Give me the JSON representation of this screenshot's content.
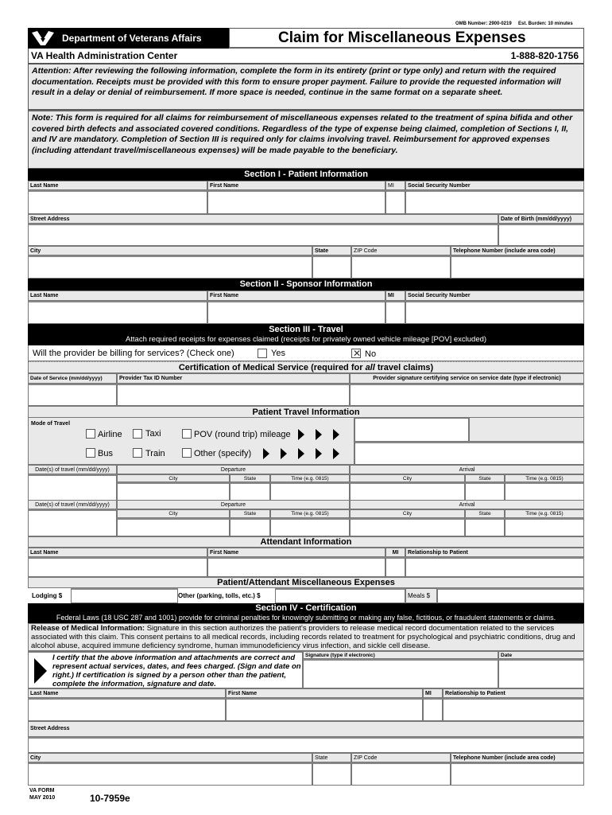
{
  "header": {
    "omb_number": "OMB Number: 2900-0219",
    "est_burden": "Est. Burden: 10 minutes",
    "agency": "Department of Veterans Affairs",
    "form_title": "Claim for Miscellaneous Expenses",
    "center": "VA Health Administration Center",
    "phone": "1-888-820-1756"
  },
  "notices": {
    "attention": "Attention: After reviewing the following information, complete the form in its entirety (print or type only) and return with the required documentation. Receipts must be provided with this form to ensure proper payment.  Failure to provide the requested information will result in a delay or denial of reimbursement. If more space is needed, continue in the same format on a separate sheet.",
    "note": "Note: This form is required for all claims for reimbursement of miscellaneous expenses related to the treatment of spina bifida and other covered birth defects and associated covered conditions. Regardless of the type of expense being claimed, completion of Sections I, II, and IV are mandatory. Completion of Section III is required only for claims involving travel. Reimbursement for approved expenses (including attendant travel/miscellaneous expenses) will be made payable to the beneficiary."
  },
  "section1": {
    "title": "Section I - Patient Information",
    "last_name": "Last Name",
    "first_name": "First Name",
    "mi": "MI",
    "ssn": "Social Security Number",
    "street": "Street Address",
    "dob": "Date of Birth (mm/dd/yyyy)",
    "city": "City",
    "state": "State",
    "zip": "ZIP Code",
    "phone": "Telephone Number (include area code)"
  },
  "section2": {
    "title": "Section II  - Sponsor Information",
    "last_name": "Last Name",
    "first_name": "First Name",
    "mi": "MI",
    "ssn": "Social Security Number"
  },
  "section3": {
    "title": "Section III - Travel",
    "subtitle": "Attach required receipts for expenses claimed (receipts for privately owned vehicle mileage [POV] excluded)",
    "billing_question": "Will the provider be billing for services? (Check one)",
    "yes_label": "Yes",
    "no_label": "No",
    "yes_checked": false,
    "no_checked": true,
    "cert_title_pre": "Certification of Medical Service (required for ",
    "cert_title_em": "all",
    "cert_title_post": " travel claims)",
    "date_of_service": "Date of Service (mm/dd/yyyy)",
    "provider_tax_id": "Provider Tax ID Number",
    "provider_signature": "Provider signature certifying service on service date (type if electronic)",
    "travel_info_title": "Patient Travel Information",
    "mode_of_travel": "Mode of Travel",
    "modes": {
      "airline": "Airline",
      "taxi": "Taxi",
      "pov": "POV (round trip) mileage",
      "bus": "Bus",
      "train": "Train",
      "other": "Other (specify)"
    },
    "trips": [
      {
        "date_label": "Date(s) of travel (mm/dd/yyyy)",
        "departure": "Departure",
        "arrival": "Arrival",
        "city": "City",
        "state": "State",
        "time": "Time (e.g. 0815)"
      },
      {
        "date_label": "Date(s) of travel (mm/dd/yyyy)",
        "departure": "Departure",
        "arrival": "Arrival",
        "city": "City",
        "state": "State",
        "time": "Time (e.g. 0815)"
      }
    ],
    "attendant_title": "Attendant Information",
    "att_last_name": "Last Name",
    "att_first_name": "First Name",
    "att_mi": "MI",
    "att_relationship": "Relationship to Patient",
    "misc_title": "Patient/Attendant Miscellaneous Expenses",
    "lodging": "Lodging  $",
    "other": "Other (parking, tolls, etc.)  $",
    "meals": "Meals  $"
  },
  "section4": {
    "title": "Section IV  - Certification",
    "federal_laws": "Federal Laws (18 USC 287 and 1001) provide for criminal penalties for knowingly submitting or making any false, fictitious, or fraudulent statements or claims.",
    "release_bold": "Release of Medical Information:",
    "release_text": " Signature in this section authorizes the patient's providers to release medical record documentation related to the services associated with this claim. This consent pertains to all medical records, including records related to treatment for psychological and psychiatric conditions, drug and alcohol abuse, acquired immune deficiency syndrome, human immunodeficiency virus infection, and sickle cell disease.",
    "certify": "I certify that the above information and attachments are correct and represent actual services, dates, and fees charged. (Sign and date on right.) If certification is signed by a person other than the patient, complete the information, signature and date.",
    "signature": "Signature (type if electronic)",
    "date": "Date",
    "last_name": "Last Name",
    "first_name": "First Name",
    "mi": "MI",
    "relationship": "Relationship to Patient",
    "street": "Street Address",
    "city": "City",
    "state": "State",
    "zip": "ZIP Code",
    "phone": "Telephone Number (include area code)"
  },
  "footer": {
    "va_form": "VA FORM",
    "date": "MAY 2010",
    "form_number": "10-7959e"
  }
}
